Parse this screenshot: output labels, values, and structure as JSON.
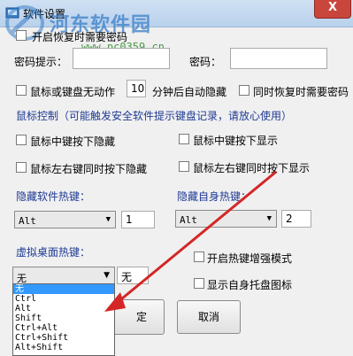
{
  "window": {
    "title": "软件设置",
    "close_glyph": "X"
  },
  "watermark": {
    "text": "河东软件园",
    "url": "www.pc0359.cn"
  },
  "password": {
    "require_on_start_label": "开启恢复时需要密码",
    "hint_label": "密码提示：",
    "hint_value": "",
    "password_label": "密码：",
    "password_value": ""
  },
  "idle": {
    "label_before": "鼠标或键盘无动作",
    "minutes": "10",
    "label_after": "分钟后自动隐藏",
    "restore_needs_password_label": "同时恢复时需要密码"
  },
  "mouse_control": {
    "heading": "鼠标控制（可能触发安全软件提示键盘记录，请放心使用）",
    "middle_hide": "鼠标中键按下隐藏",
    "middle_show": "鼠标中键按下显示",
    "lr_hide": "鼠标左右键同时按下隐藏",
    "lr_show": "鼠标左右键同时按下显示"
  },
  "hotkeys": {
    "hide_app_label": "隐藏软件热键：",
    "hide_app_modifier": "Alt",
    "hide_app_key": "1",
    "hide_self_label": "隐藏自身热键：",
    "hide_self_modifier": "Alt",
    "hide_self_key": "2",
    "virtual_desktop_label": "虚拟桌面热键：",
    "virtual_desktop_modifier": "无",
    "virtual_desktop_key": "无"
  },
  "options": {
    "enhanced_hotkey_label": "开启热键增强模式",
    "show_tray_label": "显示自身托盘图标"
  },
  "dropdown_options": [
    "无",
    "Ctrl",
    "Alt",
    "Shift",
    "Ctrl+Alt",
    "Ctrl+Shift",
    "Alt+Shift"
  ],
  "buttons": {
    "ok_partial": "定",
    "cancel": "取消"
  },
  "colors": {
    "heading_blue": "#1f3a93",
    "arrow_red": "#d42626",
    "selection_blue": "#3399ff"
  }
}
